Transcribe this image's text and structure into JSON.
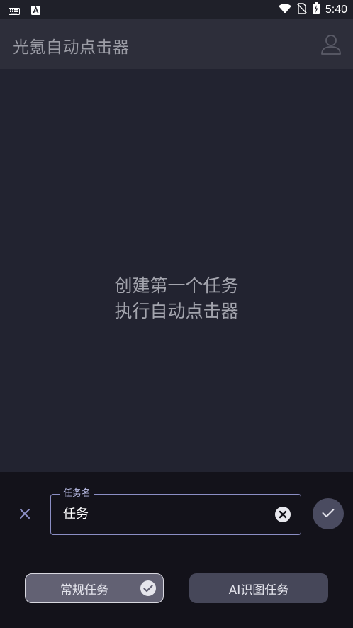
{
  "status_bar": {
    "time": "5:40",
    "left_icons": [
      "keyboard-icon",
      "text-a-icon"
    ],
    "right_icons": [
      "wifi-icon",
      "no-sim-icon",
      "battery-charging-icon"
    ]
  },
  "app_bar": {
    "title": "光氪自动点击器",
    "profile_icon": "user-icon"
  },
  "empty_state": {
    "line1": "创建第一个任务",
    "line2": "执行自动点击器"
  },
  "task_sheet": {
    "close_icon": "close-icon",
    "name_field": {
      "label": "任务名",
      "value": "任务",
      "clear_icon": "clear-circle-icon"
    },
    "confirm_icon": "check-icon",
    "types": [
      {
        "label": "常规任务",
        "selected": true
      },
      {
        "label": "AI识图任务",
        "selected": false
      }
    ]
  },
  "colors": {
    "background": "#222330",
    "app_bar": "#2d2e3a",
    "sheet": "#13121a",
    "field_border": "#8b8ec4",
    "selected_button": "#626173",
    "button": "#464759"
  }
}
